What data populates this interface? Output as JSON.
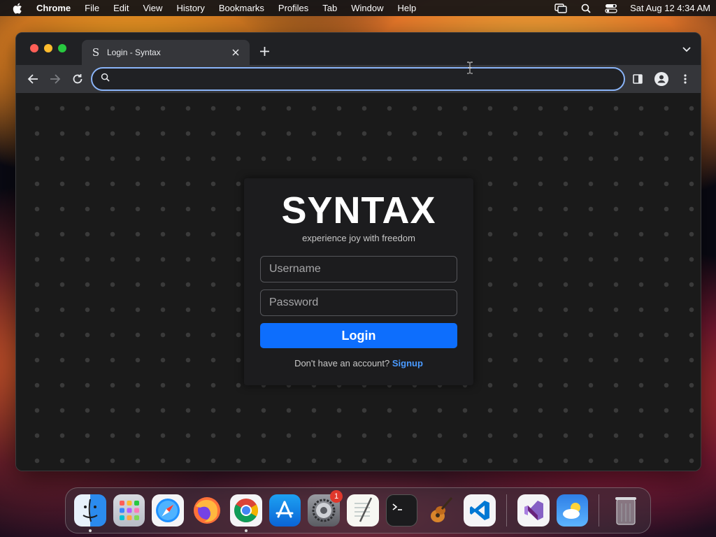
{
  "menubar": {
    "app_name": "Chrome",
    "items": [
      "File",
      "Edit",
      "View",
      "History",
      "Bookmarks",
      "Profiles",
      "Tab",
      "Window",
      "Help"
    ],
    "clock": "Sat Aug 12  4:34 AM"
  },
  "browser": {
    "tab": {
      "title": "Login - Syntax",
      "favicon": "S"
    },
    "omnibox": {
      "value": "",
      "placeholder": ""
    }
  },
  "page": {
    "brand": "SYNTAX",
    "tagline": "experience joy with freedom",
    "username_placeholder": "Username",
    "password_placeholder": "Password",
    "login_label": "Login",
    "signup_prompt": "Don't have an account?",
    "signup_link": "Signup"
  },
  "dock": {
    "apps": [
      "finder",
      "launchpad",
      "safari",
      "firefox",
      "chrome",
      "app-store",
      "system-settings",
      "textedit",
      "terminal",
      "garageband",
      "vscode",
      "visual-studio",
      "weather",
      "trash"
    ],
    "badge": "1"
  },
  "colors": {
    "accent": "#0d6efd",
    "link": "#4a9aff",
    "focus_ring": "#8ab4f8"
  }
}
